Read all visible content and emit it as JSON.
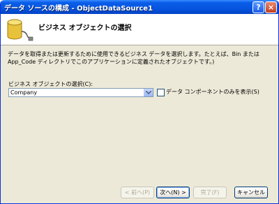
{
  "window": {
    "title": "データ ソースの構成 - ObjectDataSource1",
    "help_label": "?",
    "close_label": "×"
  },
  "header": {
    "title": "ビジネス オブジェクトの選択"
  },
  "description": "データを取得または更新するために使用できるビジネス データを選択します。たとえば、Bin または App_Code ディレクトリでこのアプリケーションに定義されたオブジェクトです。)",
  "business_object": {
    "label": "ビジネス オブジェクトの選択(C):",
    "selected": "Company"
  },
  "filter_checkbox": {
    "label": "データ コンポーネントのみを表示(S)",
    "checked": false
  },
  "buttons": {
    "back": "< 前へ(P)",
    "next": "次へ(N) >",
    "finish": "完了(F)",
    "cancel": "キャンセル"
  },
  "colors": {
    "titlebar": "#0755e0",
    "dialog_bg": "#ece9d8",
    "database_icon": "#e8c23a"
  },
  "icons": {
    "header": "database-icon",
    "dropdown": "chevron-down-icon"
  }
}
